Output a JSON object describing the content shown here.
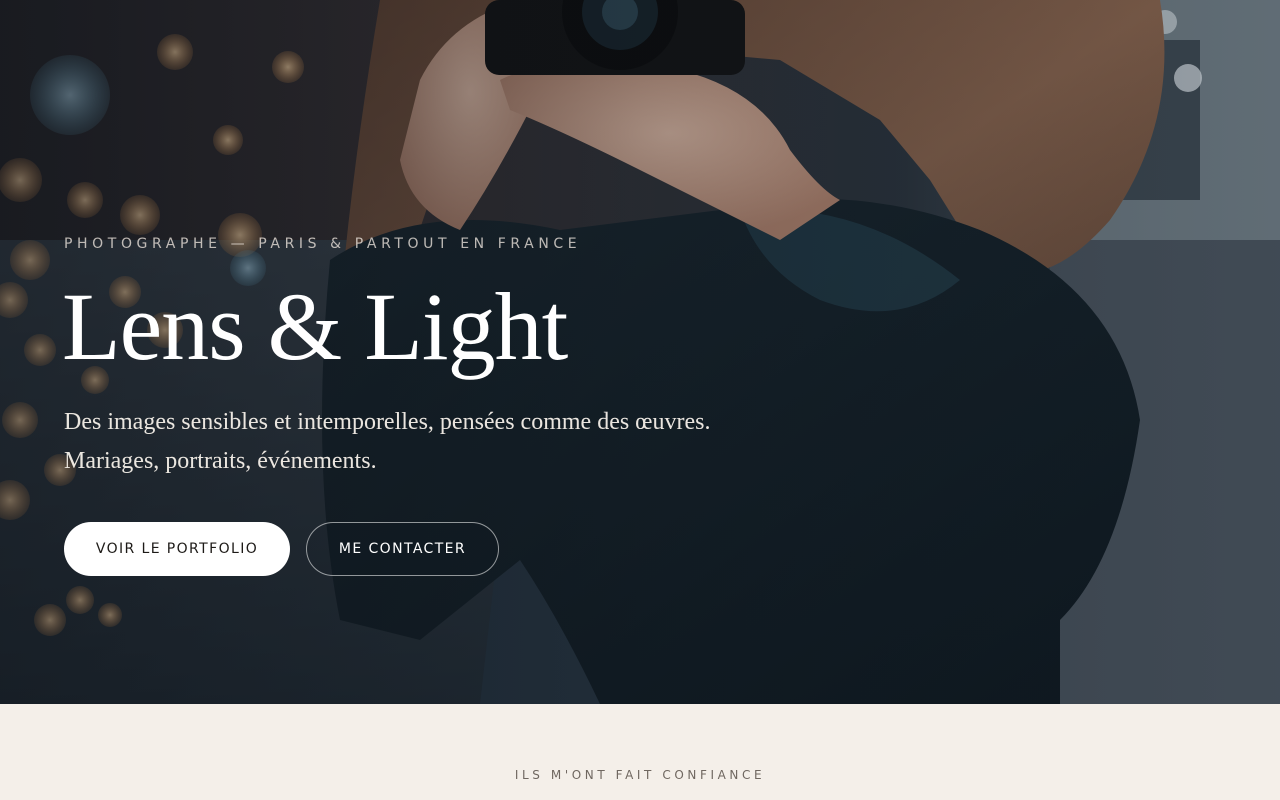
{
  "hero": {
    "eyebrow": "PHOTOGRAPHE — PARIS & PARTOUT EN FRANCE",
    "title": "Lens & Light",
    "subtitle_lines": [
      "Des images sensibles et intemporelles, pensées comme des œuvres.",
      "Mariages, portraits, événements."
    ],
    "primary_button": "VOIR LE PORTFOLIO",
    "secondary_button": "ME CONTACTER",
    "photo": "photographer-with-camera-night-bokeh"
  },
  "trust": {
    "label": "ILS M'ONT FAIT CONFIANCE"
  },
  "colors": {
    "page_background": "#f4efe9",
    "hero_text": "#ffffff",
    "primary_button_bg": "#ffffff",
    "primary_button_text": "#1d1a17",
    "trust_label": "#6f6760"
  }
}
